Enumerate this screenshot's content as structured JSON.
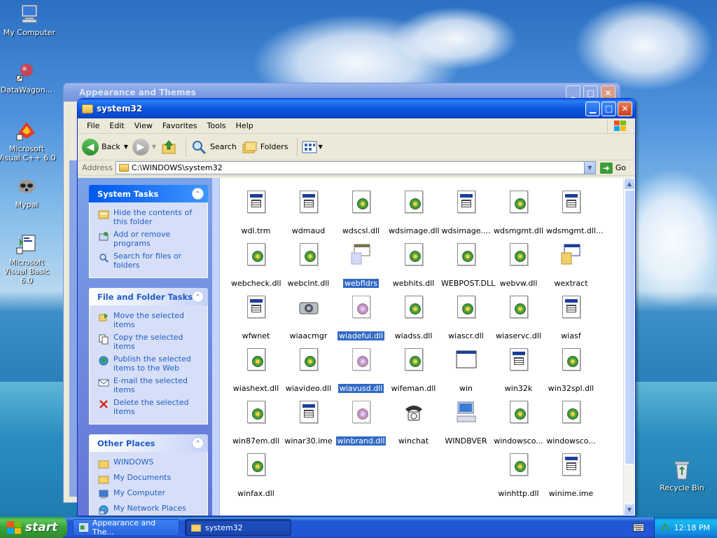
{
  "desktop": {
    "icons": [
      {
        "label": "My Computer"
      },
      {
        "label": "DataWagon..."
      },
      {
        "label": "Microsoft Visual C++ 6.0"
      },
      {
        "label": "Mypal"
      },
      {
        "label": "Microsoft Visual Basic 6.0"
      },
      {
        "label": "Recycle Bin"
      }
    ]
  },
  "back_window": {
    "title": "Appearance and Themes"
  },
  "window": {
    "title": "system32",
    "menu": [
      "File",
      "Edit",
      "View",
      "Favorites",
      "Tools",
      "Help"
    ],
    "toolbar": {
      "back": "Back",
      "search": "Search",
      "folders": "Folders"
    },
    "address": {
      "label": "Address",
      "value": "C:\\WINDOWS\\system32",
      "go": "Go"
    },
    "panels": [
      {
        "title": "System Tasks",
        "tasks": [
          "Hide the contents of this folder",
          "Add or remove programs",
          "Search for files or folders"
        ]
      },
      {
        "title": "File and Folder Tasks",
        "tasks": [
          "Move the selected items",
          "Copy the selected items",
          "Publish the selected items to the Web",
          "E-mail the selected items",
          "Delete the selected items"
        ]
      },
      {
        "title": "Other Places",
        "tasks": [
          "WINDOWS",
          "My Documents",
          "My Computer",
          "My Network Places"
        ]
      }
    ],
    "files": [
      {
        "name": "wdl.trm",
        "kind": "text"
      },
      {
        "name": "wdmaud",
        "kind": "text"
      },
      {
        "name": "wdscsl.dll",
        "kind": "dll"
      },
      {
        "name": "wdsimage.dll",
        "kind": "dll"
      },
      {
        "name": "wdsimage....",
        "kind": "text"
      },
      {
        "name": "wdsmgmt.dll",
        "kind": "dll"
      },
      {
        "name": "wdsmgmt.dll...",
        "kind": "text"
      },
      {
        "name": "webcheck.dll",
        "kind": "dll"
      },
      {
        "name": "webclnt.dll",
        "kind": "dll"
      },
      {
        "name": "webfldrs",
        "kind": "app",
        "selected": true
      },
      {
        "name": "webhits.dll",
        "kind": "dll"
      },
      {
        "name": "WEBPOST.DLL",
        "kind": "dll"
      },
      {
        "name": "webvw.dll",
        "kind": "dll"
      },
      {
        "name": "wextract",
        "kind": "app"
      },
      {
        "name": "wfwnet",
        "kind": "text"
      },
      {
        "name": "wiaacmgr",
        "kind": "camera"
      },
      {
        "name": "wiadefui.dll",
        "kind": "dll",
        "selected": true
      },
      {
        "name": "wiadss.dll",
        "kind": "dll"
      },
      {
        "name": "wiascr.dll",
        "kind": "dll"
      },
      {
        "name": "wiaservc.dll",
        "kind": "dll"
      },
      {
        "name": "wiasf",
        "kind": "text"
      },
      {
        "name": "wiashext.dll",
        "kind": "dll"
      },
      {
        "name": "wiavideo.dll",
        "kind": "dll"
      },
      {
        "name": "wiavusd.dll",
        "kind": "dll",
        "selected": true
      },
      {
        "name": "wifeman.dll",
        "kind": "dll"
      },
      {
        "name": "win",
        "kind": "window"
      },
      {
        "name": "win32k",
        "kind": "text"
      },
      {
        "name": "win32spl.dll",
        "kind": "dll"
      },
      {
        "name": "win87em.dll",
        "kind": "dll"
      },
      {
        "name": "winar30.ime",
        "kind": "text"
      },
      {
        "name": "winbrand.dll",
        "kind": "dll",
        "selected": true
      },
      {
        "name": "winchat",
        "kind": "phone"
      },
      {
        "name": "WINDBVER",
        "kind": "computer"
      },
      {
        "name": "windowsco...",
        "kind": "dll"
      },
      {
        "name": "windowsco...",
        "kind": "dll"
      },
      {
        "name": "winfax.dll",
        "kind": "dll"
      },
      {
        "name": "",
        "kind": "none"
      },
      {
        "name": "",
        "kind": "none"
      },
      {
        "name": "",
        "kind": "none"
      },
      {
        "name": "",
        "kind": "none"
      },
      {
        "name": "winhttp.dll",
        "kind": "dll"
      },
      {
        "name": "winime.ime",
        "kind": "text"
      }
    ]
  },
  "taskbar": {
    "start": "start",
    "tasks": [
      {
        "label": "Appearance and The..."
      },
      {
        "label": "system32"
      }
    ],
    "clock": "12:18 PM"
  }
}
